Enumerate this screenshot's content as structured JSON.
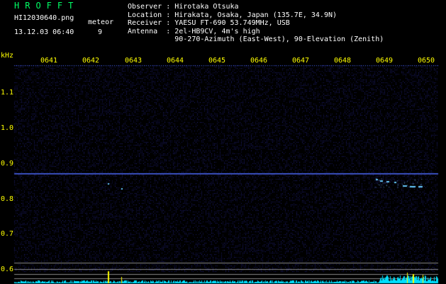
{
  "header": {
    "logo": "HROFFT",
    "filename": "HI12030640.png",
    "datetime": "13.12.03 06:40",
    "meteor_label": "meteor",
    "meteor_count": "9"
  },
  "info": {
    "observer_label": "Observer",
    "observer": "Hirotaka Otsuka",
    "location_label": "Location",
    "location": "Hirakata, Osaka, Japan (135.7E, 34.9N)",
    "receiver_label": "Receiver",
    "receiver": "YAESU FT-690 53.749MHz, USB",
    "antenna_label": "Antenna",
    "antenna": "2el-HB9CV, 4m's high",
    "antenna_detail": "90-270-Azimuth (East-West), 90-Elevation (Zenith)"
  },
  "axes": {
    "y_unit": "kHz",
    "y_ticks": [
      "1.1",
      "1.0",
      "0.9",
      "0.8",
      "0.7",
      "0.6"
    ],
    "x_ticks": [
      "0641",
      "0642",
      "0643",
      "0644",
      "0645",
      "0646",
      "0647",
      "0648",
      "0649",
      "0650"
    ]
  },
  "colors": {
    "background": "#000000",
    "noise": "#2a2aa0",
    "carrier": "#4a6aff",
    "meteor": "#66ccff",
    "tick": "#ffff00",
    "logo": "#00ff66",
    "baseline": "#00e0ff",
    "gridline": "#888888"
  }
}
